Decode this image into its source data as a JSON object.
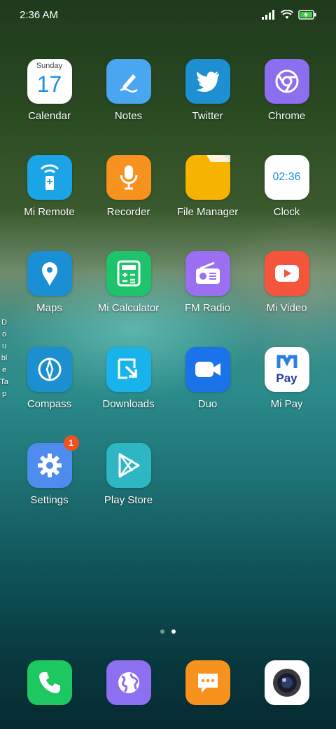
{
  "status": {
    "time": "2:36 AM"
  },
  "apps": [
    {
      "label": "Calendar",
      "weekday": "Sunday",
      "day": "17"
    },
    {
      "label": "Notes"
    },
    {
      "label": "Twitter"
    },
    {
      "label": "Chrome"
    },
    {
      "label": "Mi Remote"
    },
    {
      "label": "Recorder"
    },
    {
      "label": "File Manager"
    },
    {
      "label": "Clock",
      "time": "02:36"
    },
    {
      "label": "Maps"
    },
    {
      "label": "Mi Calculator"
    },
    {
      "label": "FM Radio"
    },
    {
      "label": "Mi Video"
    },
    {
      "label": "Compass"
    },
    {
      "label": "Downloads"
    },
    {
      "label": "Duo"
    },
    {
      "label": "Mi Pay",
      "brand": "Pay"
    },
    {
      "label": "Settings",
      "badge": "1"
    },
    {
      "label": "Play Store"
    }
  ],
  "side_hint": "Double Tap",
  "colors": {
    "notes": "#4aa6f0",
    "twitter": "#1e8fd0",
    "chrome": "#8c6ff0",
    "miremote": "#1ba5e6",
    "recorder": "#f7921e",
    "filemanager": "#f6b400",
    "maps": "#1a8fd3",
    "calculator": "#1ec46c",
    "radio": "#9a6ff2",
    "video": "#f5553b",
    "compass": "#1b8fd0",
    "downloads": "#17b3ea",
    "duo": "#1a73e8",
    "settings": "#4f8cf0",
    "playstore": "#2eb6c5",
    "phone": "#1ec860",
    "browser": "#8d6ff2",
    "messages": "#f7921e",
    "badge": "#f0511f"
  }
}
